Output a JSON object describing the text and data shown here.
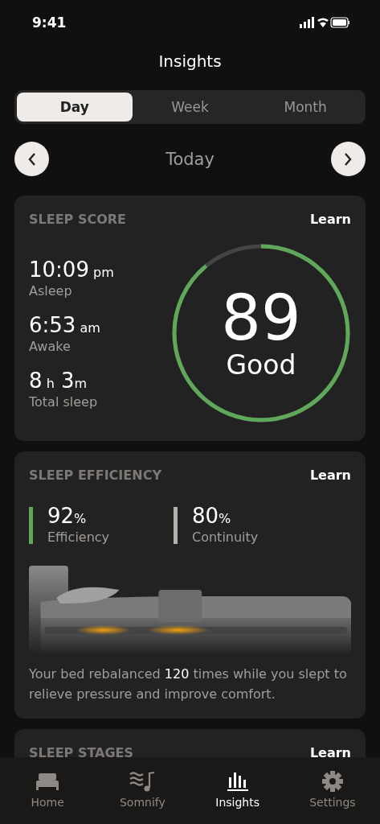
{
  "status_bar": {
    "time": "9:41"
  },
  "title": "Insights",
  "tabs": [
    {
      "label": "Day",
      "selected": true
    },
    {
      "label": "Week",
      "selected": false
    },
    {
      "label": "Month",
      "selected": false
    }
  ],
  "date_nav": {
    "label": "Today"
  },
  "sleep_score": {
    "heading": "SLEEP SCORE",
    "learn": "Learn",
    "stats": [
      {
        "value": "10:09",
        "unit": "pm",
        "label": "Asleep"
      },
      {
        "value": "6:53",
        "unit": "am",
        "label": "Awake"
      },
      {
        "value": "8",
        "unit": "h",
        "value_2": "3",
        "unit_2": "m",
        "label": "Total sleep"
      }
    ],
    "score": "89",
    "rating": "Good",
    "level": 0.89
  },
  "sleep_efficiency": {
    "heading": "SLEEP EFFICIENCY",
    "learn": "Learn",
    "metrics": [
      {
        "value": "92",
        "unit": "%",
        "label": "Efficiency",
        "color": "#5fa85a"
      },
      {
        "value": "80",
        "unit": "%",
        "label": "Continuity",
        "color": "#b5afa9"
      }
    ],
    "caption": "Your bed rebalanced **120** times while you slept to relieve pressure and improve comfort."
  },
  "sleep_stages": {
    "heading": "SLEEP STAGES",
    "learn": "Learn"
  },
  "tab_bar": [
    {
      "label": "Home",
      "kind": "bed",
      "selected": false
    },
    {
      "label": "Somnify",
      "kind": "music",
      "selected": false
    },
    {
      "label": "Insights",
      "kind": "bars",
      "selected": true
    },
    {
      "label": "Settings",
      "kind": "gear",
      "selected": false
    }
  ]
}
